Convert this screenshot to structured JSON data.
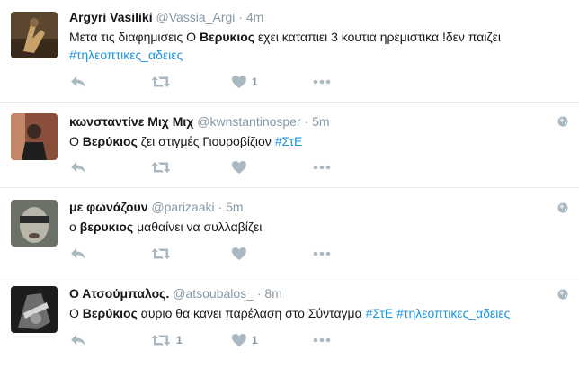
{
  "colors": {
    "icon": "#aab8c2",
    "hashtag": "#1b95e0",
    "meta": "#8899a6"
  },
  "tweets": [
    {
      "fullname": "Argyri Vasiliki",
      "username": "@Vassia_Argi",
      "dot": "·",
      "time": "4m",
      "text_before": "Μετα τις διαφημισεις Ο ",
      "bold": "Βερυκιος",
      "text_after": "  εχει καταπιει 3 κουτια ηρεμιστικα !δεν παιζει ",
      "hashtags": "#τηλεοπτικες_αδειες",
      "retweets": "",
      "likes": "1"
    },
    {
      "fullname": "κωνσταντίνε Μιχ Μιχ",
      "username": "@kwnstantinosper",
      "dot": "·",
      "time": "5m",
      "text_before": "Ο ",
      "bold": "Βερύκιος",
      "text_after": " ζει στιγμές Γιουροβίζιον ",
      "hashtags": "#ΣτΕ",
      "retweets": "",
      "likes": ""
    },
    {
      "fullname": "με φωνάζουν",
      "username": "@parizaaki",
      "dot": "·",
      "time": "5m",
      "text_before": "ο ",
      "bold": "βερυκιος",
      "text_after": " μαθαίνει να συλλαβίζει",
      "hashtags": "",
      "retweets": "",
      "likes": ""
    },
    {
      "fullname": "Ο Ατσούμπαλος.",
      "username": "@atsoubalos_",
      "dot": "·",
      "time": "8m",
      "text_before": "Ο ",
      "bold": "Βερύκιος",
      "text_after": " αυριο θα κανει παρέλαση στο Σύνταγμα ",
      "hashtags": "#ΣτΕ #τηλεοπτικες_αδειες",
      "retweets": "1",
      "likes": "1"
    }
  ]
}
